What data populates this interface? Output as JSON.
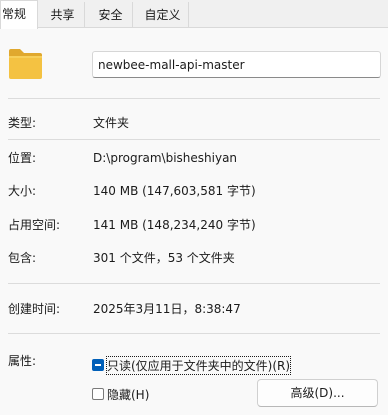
{
  "tabs": [
    {
      "label": "常规",
      "active": true
    },
    {
      "label": "共享",
      "active": false
    },
    {
      "label": "安全",
      "active": false
    },
    {
      "label": "自定义",
      "active": false
    }
  ],
  "folder_name": "newbee-mall-api-master",
  "props": {
    "type": {
      "label": "类型:",
      "value": "文件夹"
    },
    "location": {
      "label": "位置:",
      "value": "D:\\program\\bisheshiyan"
    },
    "size": {
      "label": "大小:",
      "value": "140 MB (147,603,581 字节)"
    },
    "size_on_disk": {
      "label": "占用空间:",
      "value": "141 MB (148,234,240 字节)"
    },
    "contains": {
      "label": "包含:",
      "value": "301 个文件，53 个文件夹"
    },
    "created": {
      "label": "创建时间:",
      "value": "2025年3月11日，8:38:47"
    }
  },
  "attributes": {
    "label": "属性:",
    "readonly_label": "只读(仅应用于文件夹中的文件)(R)",
    "readonly_state": "indeterminate",
    "hidden_label": "隐藏(H)",
    "hidden_state": "unchecked",
    "advanced_label": "高级(D)..."
  },
  "colors": {
    "accent": "#005fb8",
    "folder": "#f4c242",
    "background": "#f9f9f9"
  },
  "icons": {
    "folder": "folder-icon"
  }
}
